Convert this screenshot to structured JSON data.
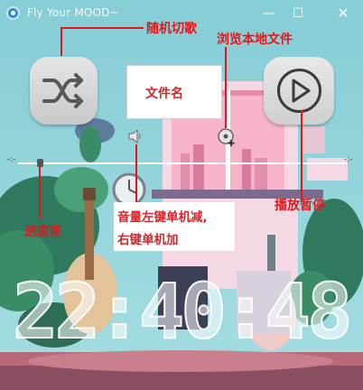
{
  "window": {
    "title": "Fly Your MOOD~",
    "minimize_glyph": "—",
    "maximize_glyph": "☐",
    "close_glyph": "✕"
  },
  "player": {
    "filename_placeholder": "文件名",
    "time_left": "-:-",
    "time_right": "-:-",
    "progress_fraction": 0.07,
    "clock": "22:40:48"
  },
  "annotations": {
    "shuffle": "随机切歌",
    "browse": "浏览本地文件",
    "play_pause": "播放暂停",
    "progress": "进度条",
    "volume_line1": "音量左键单机减,",
    "volume_line2": "右键单机加"
  },
  "icons": {
    "app": "music-note-icon",
    "shuffle": "shuffle-icon",
    "play": "play-circle-icon",
    "volume": "speaker-icon",
    "browse": "disc-add-icon"
  },
  "colors": {
    "annotation": "#e3161b",
    "background": "#8fd0d7"
  }
}
